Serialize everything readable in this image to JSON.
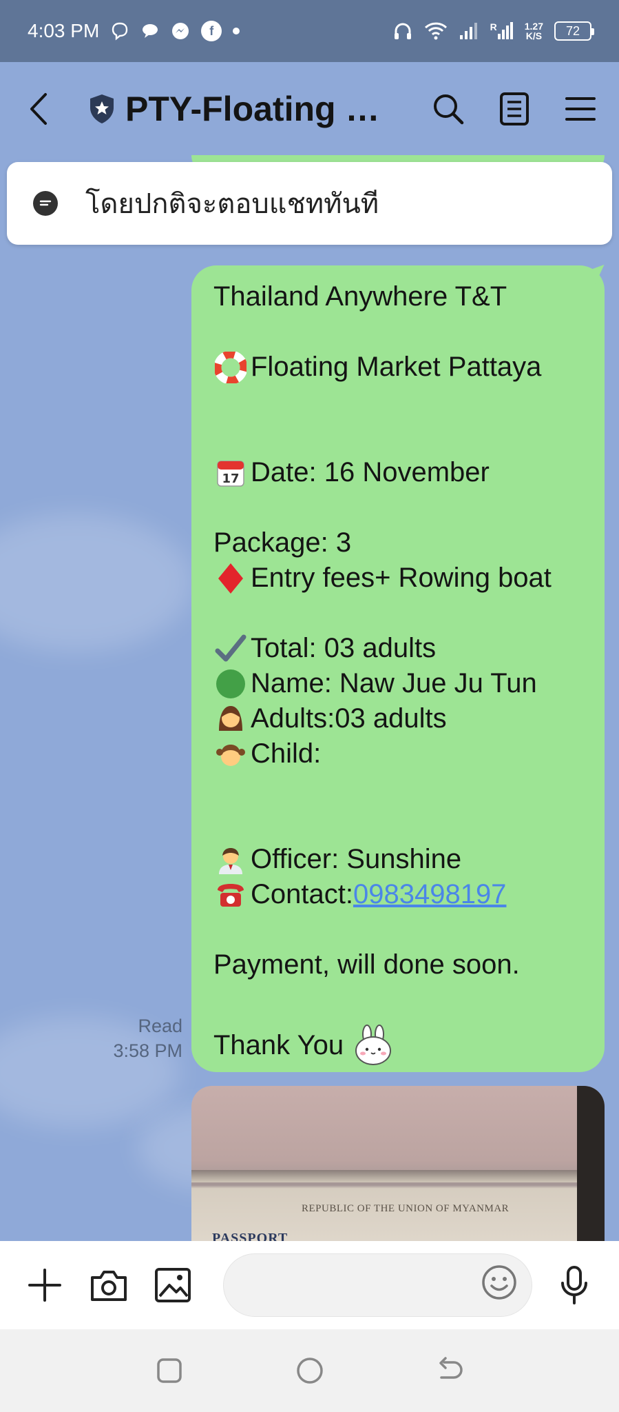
{
  "status_bar": {
    "time": "4:03 PM",
    "speed": "1.27",
    "speed_unit": "K/S",
    "battery": "72",
    "signal_label": "R",
    "icons": [
      "viber-icon",
      "chat-icon",
      "messenger-icon",
      "facebook-icon",
      "dot-icon",
      "headphones-icon",
      "wifi-icon",
      "signal-icon",
      "battery-icon"
    ]
  },
  "header": {
    "title": "PTY-Floating m...",
    "icons": [
      "back-arrow-icon",
      "shield-star-icon",
      "search-icon",
      "notes-icon",
      "menu-icon"
    ]
  },
  "notice": {
    "text": "โดยปกติจะตอบแชททันที",
    "icon": "speech-bubble-icon"
  },
  "message": {
    "lines": {
      "company": "Thailand Anywhere T&T",
      "market": "Floating Market Pattaya",
      "date": "Date: 16 November",
      "package": "Package: 3",
      "fees": " Entry fees+ Rowing boat",
      "total": "Total: 03 adults",
      "name": "Name: Naw Jue Ju Tun",
      "adults": "Adults:03 adults",
      "child": " Child:",
      "officer": "Officer: Sunshine",
      "contact_label": "Contact:",
      "contact_number": "0983498197",
      "payment": "Payment, will done soon.",
      "thanks": "Thank You"
    },
    "emoji_icons": [
      "lifebuoy-icon",
      "calendar-icon",
      "red-diamond-icon",
      "check-mark-icon",
      "green-circle-icon",
      "woman-icon",
      "girl-icon",
      "officer-icon",
      "telephone-icon",
      "bunny-sticker-icon"
    ],
    "read_label": "Read",
    "time": "3:58 PM"
  },
  "photo": {
    "caption": "REPUBLIC OF THE UNION OF MYANMAR",
    "passport_text": "PASSPORT"
  },
  "input_bar": {
    "icons": [
      "plus-icon",
      "camera-icon",
      "image-icon",
      "emoji-icon",
      "microphone-icon"
    ]
  },
  "nav_bar": {
    "icons": [
      "recent-apps-icon",
      "home-icon",
      "back-icon"
    ]
  }
}
